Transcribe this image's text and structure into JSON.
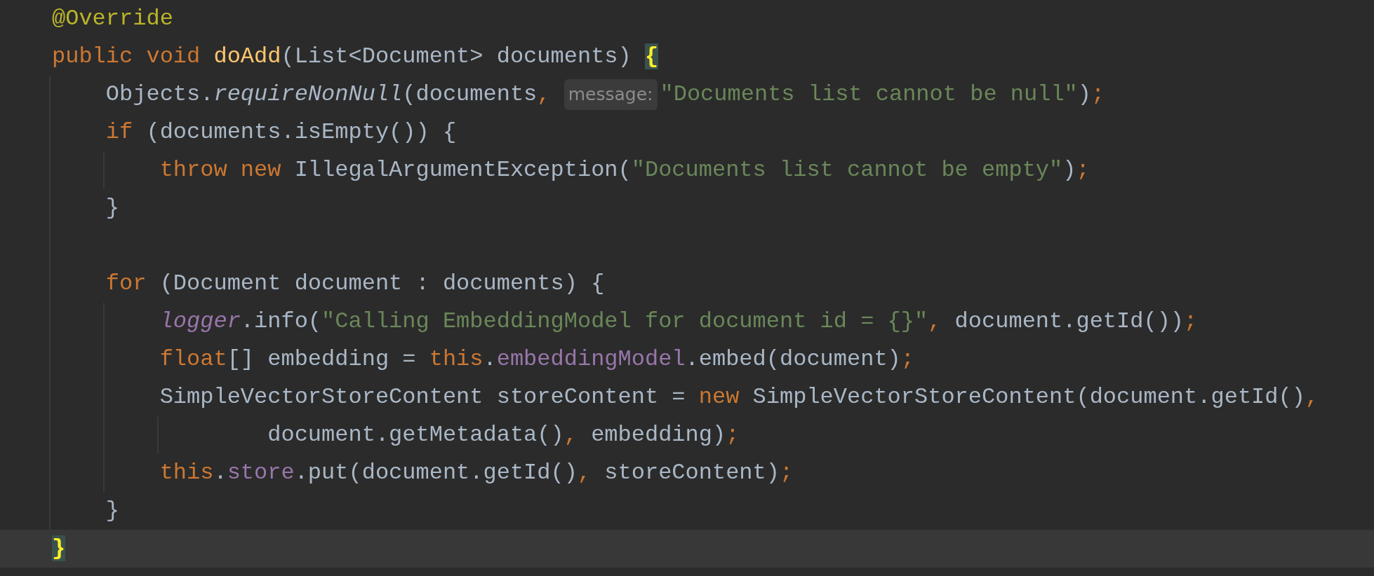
{
  "editor": {
    "lines": [
      {
        "kind": "code",
        "current": false,
        "tokens": [
          {
            "text": "@Override",
            "kind": "annotation"
          }
        ]
      },
      {
        "kind": "code",
        "current": false,
        "tokens": [
          {
            "text": "public void ",
            "kind": "keyword"
          },
          {
            "text": "doAdd",
            "kind": "method"
          },
          {
            "text": "(List<Document> documents) ",
            "kind": "plain"
          },
          {
            "text": "{",
            "kind": "brace-match"
          }
        ],
        "children": [
          {
            "kind": "code",
            "current": false,
            "tokens": [
              {
                "text": "Objects.",
                "kind": "plain"
              },
              {
                "text": "requireNonNull",
                "kind": "static-method"
              },
              {
                "text": "(documents",
                "kind": "plain"
              },
              {
                "text": ", ",
                "kind": "punct"
              },
              {
                "text": "message:",
                "kind": "hint"
              },
              {
                "text": "\"Documents list cannot be null\"",
                "kind": "string"
              },
              {
                "text": ")",
                "kind": "plain"
              },
              {
                "text": ";",
                "kind": "punct"
              }
            ]
          },
          {
            "kind": "code",
            "current": false,
            "tokens": [
              {
                "text": "if ",
                "kind": "keyword"
              },
              {
                "text": "(documents.isEmpty()) {",
                "kind": "plain"
              }
            ],
            "children": [
              {
                "kind": "code",
                "current": false,
                "tokens": [
                  {
                    "text": "throw new ",
                    "kind": "keyword"
                  },
                  {
                    "text": "IllegalArgumentException(",
                    "kind": "plain"
                  },
                  {
                    "text": "\"Documents list cannot be empty\"",
                    "kind": "string"
                  },
                  {
                    "text": ")",
                    "kind": "plain"
                  },
                  {
                    "text": ";",
                    "kind": "punct"
                  }
                ]
              }
            ]
          },
          {
            "kind": "code",
            "current": false,
            "tokens": [
              {
                "text": "}",
                "kind": "plain"
              }
            ]
          },
          {
            "kind": "blank",
            "current": false
          },
          {
            "kind": "code",
            "current": false,
            "tokens": [
              {
                "text": "for ",
                "kind": "keyword"
              },
              {
                "text": "(Document document : documents) {",
                "kind": "plain"
              }
            ],
            "children": [
              {
                "kind": "code",
                "current": false,
                "tokens": [
                  {
                    "text": "logger",
                    "kind": "static-field"
                  },
                  {
                    "text": ".info(",
                    "kind": "plain"
                  },
                  {
                    "text": "\"Calling EmbeddingModel for document id = {}\"",
                    "kind": "string"
                  },
                  {
                    "text": ", ",
                    "kind": "punct"
                  },
                  {
                    "text": "document.getId())",
                    "kind": "plain"
                  },
                  {
                    "text": ";",
                    "kind": "punct"
                  }
                ]
              },
              {
                "kind": "code",
                "current": false,
                "tokens": [
                  {
                    "text": "float",
                    "kind": "keyword"
                  },
                  {
                    "text": "[] embedding = ",
                    "kind": "plain"
                  },
                  {
                    "text": "this",
                    "kind": "keyword"
                  },
                  {
                    "text": ".",
                    "kind": "plain"
                  },
                  {
                    "text": "embeddingModel",
                    "kind": "field"
                  },
                  {
                    "text": ".embed(document)",
                    "kind": "plain"
                  },
                  {
                    "text": ";",
                    "kind": "punct"
                  }
                ]
              },
              {
                "kind": "code",
                "current": false,
                "tokens": [
                  {
                    "text": "SimpleVectorStoreContent storeContent = ",
                    "kind": "plain"
                  },
                  {
                    "text": "new ",
                    "kind": "keyword"
                  },
                  {
                    "text": "SimpleVectorStoreContent(document.getId()",
                    "kind": "plain"
                  },
                  {
                    "text": ",",
                    "kind": "punct"
                  }
                ]
              },
              {
                "kind": "continuation",
                "current": false,
                "tokens": [
                  {
                    "text": "document.getMetadata()",
                    "kind": "plain"
                  },
                  {
                    "text": ", ",
                    "kind": "punct"
                  },
                  {
                    "text": "embedding)",
                    "kind": "plain"
                  },
                  {
                    "text": ";",
                    "kind": "punct"
                  }
                ]
              },
              {
                "kind": "code",
                "current": false,
                "tokens": [
                  {
                    "text": "this",
                    "kind": "keyword"
                  },
                  {
                    "text": ".",
                    "kind": "plain"
                  },
                  {
                    "text": "store",
                    "kind": "field"
                  },
                  {
                    "text": ".put(document.getId()",
                    "kind": "plain"
                  },
                  {
                    "text": ", ",
                    "kind": "punct"
                  },
                  {
                    "text": "storeContent)",
                    "kind": "plain"
                  },
                  {
                    "text": ";",
                    "kind": "punct"
                  }
                ]
              }
            ]
          },
          {
            "kind": "code",
            "current": false,
            "tokens": [
              {
                "text": "}",
                "kind": "plain"
              }
            ]
          }
        ]
      },
      {
        "kind": "code",
        "current": true,
        "tokens": [
          {
            "text": "}",
            "kind": "brace-match"
          }
        ]
      }
    ]
  }
}
